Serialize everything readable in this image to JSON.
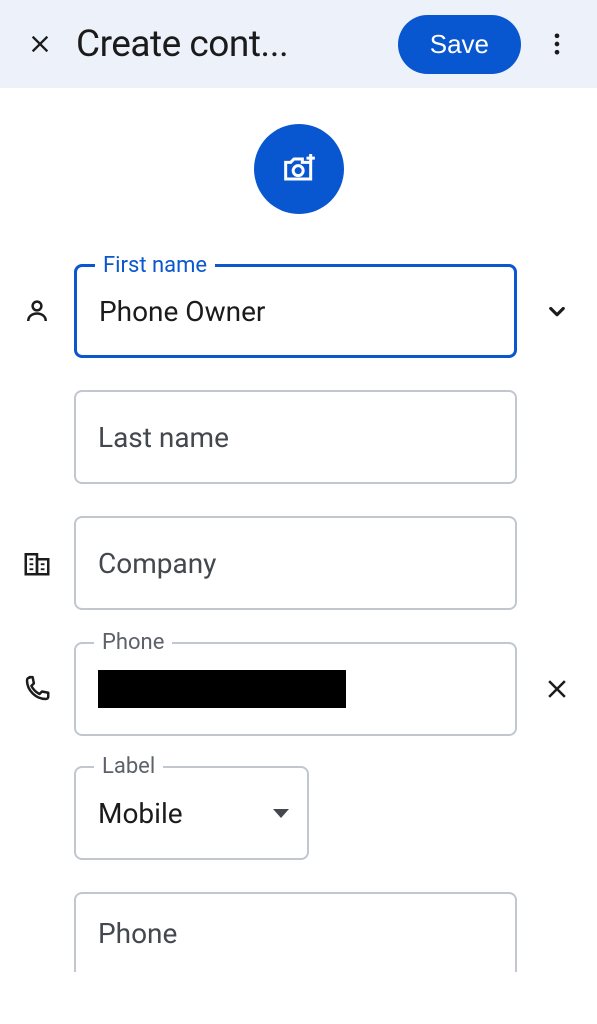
{
  "header": {
    "title": "Create cont...",
    "save_label": "Save"
  },
  "fields": {
    "first_name": {
      "label": "First name",
      "value": "Phone Owner"
    },
    "last_name": {
      "placeholder": "Last name",
      "value": ""
    },
    "company": {
      "placeholder": "Company",
      "value": ""
    },
    "phone1": {
      "label": "Phone",
      "value": ""
    },
    "phone_label_select": {
      "label": "Label",
      "value": "Mobile"
    },
    "phone2": {
      "placeholder": "Phone",
      "value": ""
    }
  }
}
